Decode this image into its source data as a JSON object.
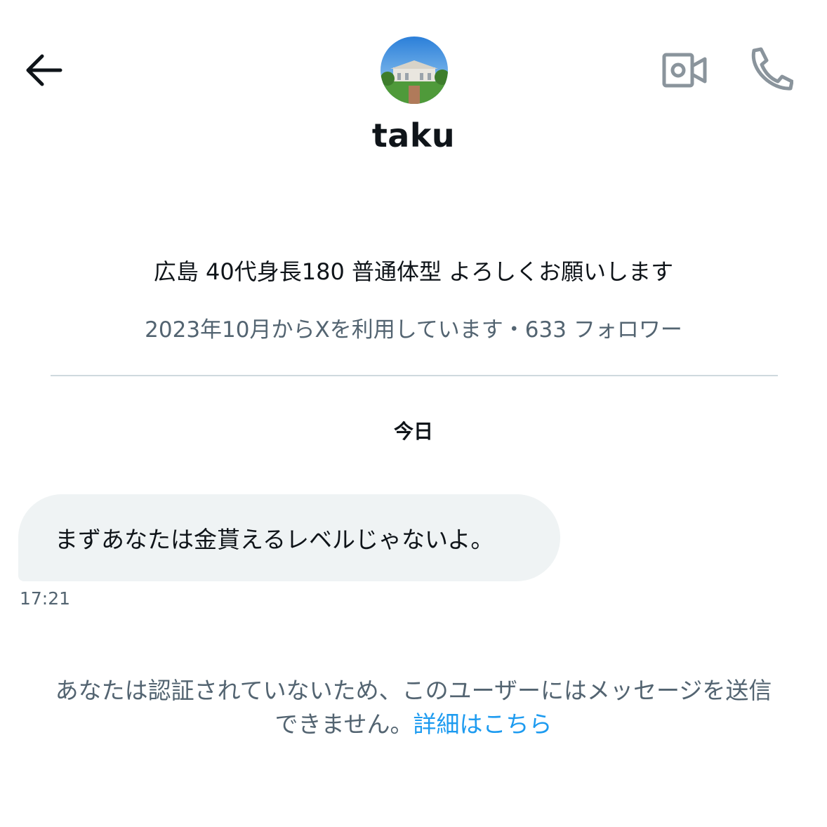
{
  "header": {
    "username": "taku",
    "back_icon": "arrow-left-icon",
    "video_icon": "video-call-icon",
    "phone_icon": "phone-icon"
  },
  "profile": {
    "bio": "広島 40代身長180 普通体型 よろしくお願いします",
    "meta": "2023年10月からXを利用しています・633 フォロワー"
  },
  "conversation": {
    "day_label": "今日",
    "messages": [
      {
        "text": "まずあなたは金貰えるレベルじゃないよ。",
        "time": "17:21"
      }
    ]
  },
  "notice": {
    "line1": "あなたは認証されていないため、このユーザーにはメッセージを送信",
    "line2_text": "できません。",
    "link": "詳細はこちら"
  },
  "colors": {
    "text": "#0f1419",
    "secondary": "#536471",
    "bubble": "#eff3f4",
    "link": "#1d9bf0",
    "divider": "#cfd9de"
  }
}
